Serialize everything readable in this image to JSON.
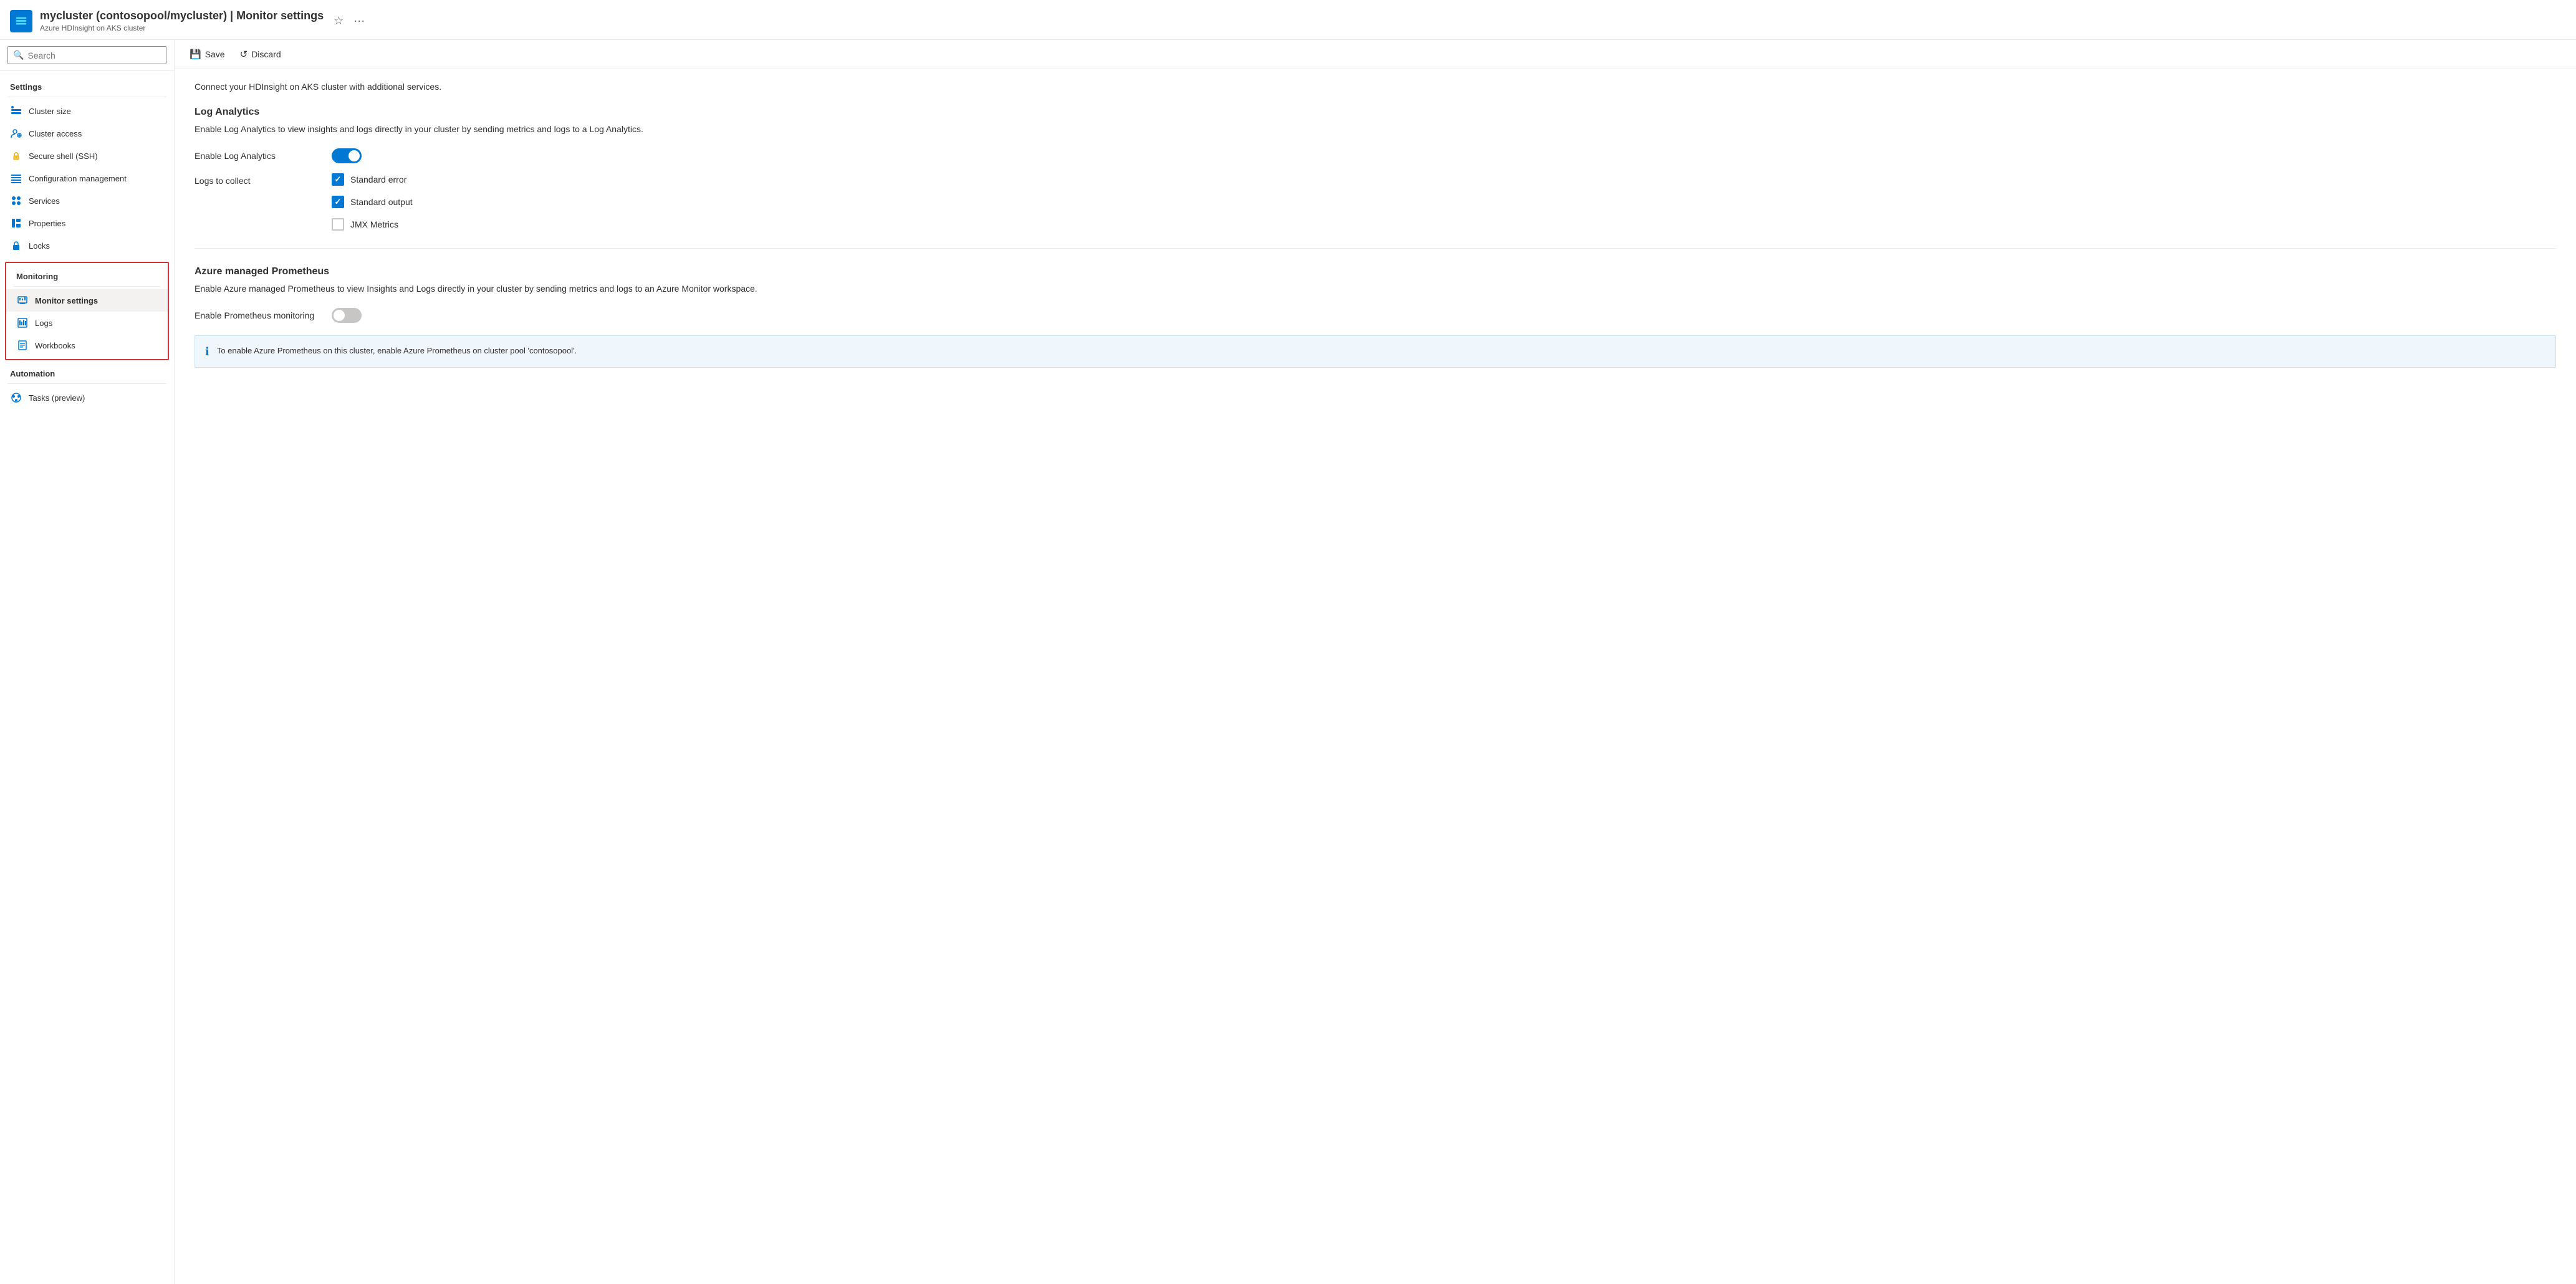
{
  "header": {
    "icon_label": "cluster-icon",
    "title": "mycluster (contosopool/mycluster) | Monitor settings",
    "subtitle": "Azure HDInsight on AKS cluster",
    "star_label": "☆",
    "ellipsis_label": "···"
  },
  "search": {
    "placeholder": "Search"
  },
  "sidebar": {
    "settings_label": "Settings",
    "items_settings": [
      {
        "id": "cluster-size",
        "label": "Cluster size",
        "icon": "cluster-size-icon"
      },
      {
        "id": "cluster-access",
        "label": "Cluster access",
        "icon": "cluster-access-icon"
      },
      {
        "id": "secure-shell",
        "label": "Secure shell (SSH)",
        "icon": "secure-shell-icon"
      },
      {
        "id": "config-management",
        "label": "Configuration management",
        "icon": "config-mgmt-icon"
      },
      {
        "id": "services",
        "label": "Services",
        "icon": "services-icon"
      },
      {
        "id": "properties",
        "label": "Properties",
        "icon": "properties-icon"
      },
      {
        "id": "locks",
        "label": "Locks",
        "icon": "locks-icon"
      }
    ],
    "monitoring_label": "Monitoring",
    "items_monitoring": [
      {
        "id": "monitor-settings",
        "label": "Monitor settings",
        "icon": "monitor-settings-icon",
        "active": true
      },
      {
        "id": "logs",
        "label": "Logs",
        "icon": "logs-icon"
      },
      {
        "id": "workbooks",
        "label": "Workbooks",
        "icon": "workbooks-icon"
      }
    ],
    "automation_label": "Automation",
    "items_automation": [
      {
        "id": "tasks-preview",
        "label": "Tasks (preview)",
        "icon": "tasks-icon"
      }
    ]
  },
  "toolbar": {
    "save_label": "Save",
    "discard_label": "Discard"
  },
  "content": {
    "connect_desc": "Connect your HDInsight on AKS cluster with additional services.",
    "log_analytics": {
      "title": "Log Analytics",
      "desc": "Enable Log Analytics to view insights and logs directly in your cluster by sending metrics and logs to a Log Analytics.",
      "enable_label": "Enable Log Analytics",
      "enable_on": true,
      "logs_label": "Logs to collect",
      "checkboxes": [
        {
          "id": "std-error",
          "label": "Standard error",
          "checked": true
        },
        {
          "id": "std-output",
          "label": "Standard output",
          "checked": true
        },
        {
          "id": "jmx-metrics",
          "label": "JMX Metrics",
          "checked": false
        }
      ]
    },
    "prometheus": {
      "title": "Azure managed Prometheus",
      "desc": "Enable Azure managed Prometheus to view Insights and Logs directly in your cluster by sending metrics and logs to an Azure Monitor workspace.",
      "enable_label": "Enable Prometheus monitoring",
      "enable_on": false,
      "info_text": "To enable Azure Prometheus on this cluster, enable Azure Prometheus on cluster pool 'contosopool'."
    }
  }
}
